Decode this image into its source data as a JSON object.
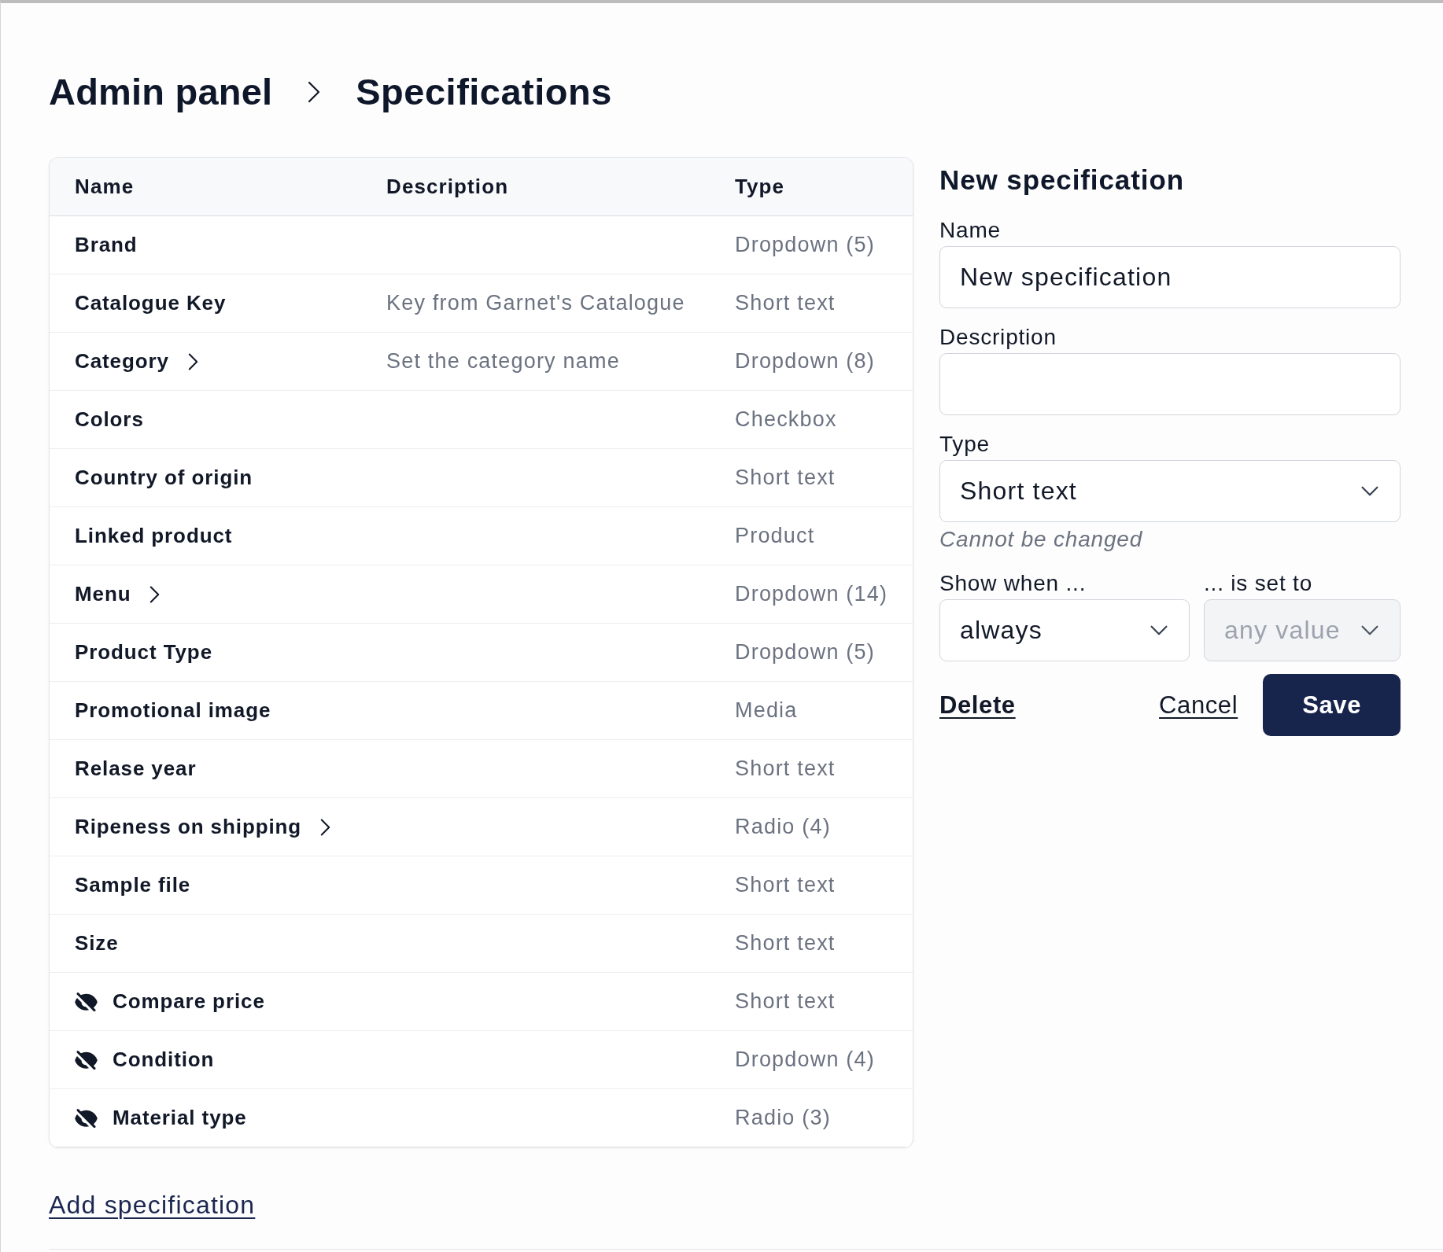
{
  "breadcrumb": [
    "Admin panel",
    "Specifications"
  ],
  "table": {
    "columns": [
      "Name",
      "Description",
      "Type"
    ],
    "rows": [
      {
        "name": "Brand",
        "type": "Dropdown (5)",
        "expandable": false,
        "hidden": false
      },
      {
        "name": "Catalogue Key",
        "description": "Key from Garnet's Catalogue",
        "type": "Short text",
        "expandable": false,
        "hidden": false
      },
      {
        "name": "Category",
        "description": "Set the category name",
        "type": "Dropdown (8)",
        "expandable": true,
        "hidden": false
      },
      {
        "name": "Colors",
        "type": "Checkbox",
        "expandable": false,
        "hidden": false
      },
      {
        "name": "Country of origin",
        "type": "Short text",
        "expandable": false,
        "hidden": false
      },
      {
        "name": "Linked product",
        "type": "Product",
        "expandable": false,
        "hidden": false
      },
      {
        "name": "Menu",
        "type": "Dropdown (14)",
        "expandable": true,
        "hidden": false
      },
      {
        "name": "Product Type",
        "type": "Dropdown (5)",
        "expandable": false,
        "hidden": false
      },
      {
        "name": "Promotional image",
        "type": "Media",
        "expandable": false,
        "hidden": false
      },
      {
        "name": "Relase year",
        "type": "Short text",
        "expandable": false,
        "hidden": false
      },
      {
        "name": "Ripeness on shipping",
        "type": "Radio (4)",
        "expandable": true,
        "hidden": false
      },
      {
        "name": "Sample file",
        "type": "Short text",
        "expandable": false,
        "hidden": false
      },
      {
        "name": "Size",
        "type": "Short text",
        "expandable": false,
        "hidden": false
      },
      {
        "name": "Compare price",
        "type": "Short text",
        "expandable": false,
        "hidden": true
      },
      {
        "name": "Condition",
        "type": "Dropdown (4)",
        "expandable": false,
        "hidden": true
      },
      {
        "name": "Material type",
        "type": "Radio (3)",
        "expandable": false,
        "hidden": true
      }
    ]
  },
  "add_link": "Add specification",
  "form": {
    "title": "New specification",
    "fields": [
      {
        "kind": "text",
        "label": "Name",
        "value": "New specification",
        "disabled": false
      },
      {
        "kind": "text",
        "label": "Description",
        "disabled": false
      },
      {
        "kind": "select",
        "label": "Type",
        "value": "Short text",
        "disabled": false,
        "note": "Cannot be changed"
      }
    ],
    "conditions": [
      {
        "label": "Show when ...",
        "value": "always",
        "disabled": false
      },
      {
        "label": "... is set to",
        "value": "any value",
        "disabled": true
      }
    ],
    "buttons": [
      {
        "kind": "strong-link",
        "label": "Delete"
      },
      {
        "kind": "link",
        "label": "Cancel"
      },
      {
        "kind": "primary",
        "label": "Save"
      }
    ]
  }
}
